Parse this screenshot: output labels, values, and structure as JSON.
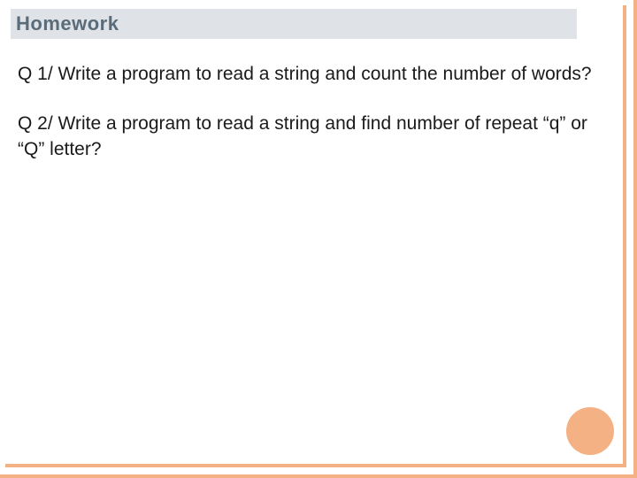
{
  "title": "Homework",
  "questions": [
    "Q 1/ Write a program to read a string and count the number of words?",
    "Q 2/ Write a program to read a string and find number of repeat “q” or “Q” letter?"
  ]
}
